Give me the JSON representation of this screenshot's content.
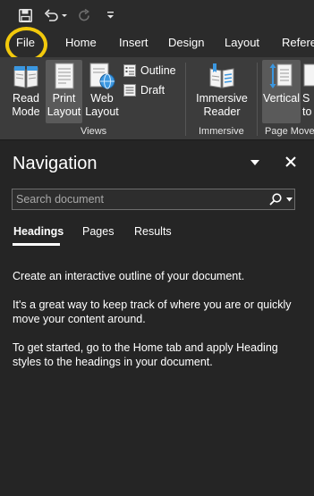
{
  "quick_access": {
    "save_icon": "save-icon",
    "undo_icon": "undo-icon",
    "redo_icon": "redo-icon",
    "customize_icon": "customize-toolbar-icon"
  },
  "ribbon_tabs": [
    "File",
    "Home",
    "Insert",
    "Design",
    "Layout",
    "Referen"
  ],
  "ribbon": {
    "views": {
      "read_mode": "Read\nMode",
      "print_layout": "Print\nLayout",
      "web_layout": "Web\nLayout",
      "outline": "Outline",
      "draft": "Draft",
      "group_label": "Views"
    },
    "immersive": {
      "immersive_reader": "Immersive\nReader",
      "group_label": "Immersive"
    },
    "page_movement": {
      "vertical": "Vertical",
      "side_to_side": "S\nto",
      "group_label": "Page Move"
    }
  },
  "navigation": {
    "title": "Navigation",
    "search_placeholder": "Search document",
    "tabs": [
      "Headings",
      "Pages",
      "Results"
    ],
    "active_tab": "Headings",
    "paragraphs": [
      "Create an interactive outline of your document.",
      "It's a great way to keep track of where you are or quickly move your content around.",
      "To get started, go to the Home tab and apply Heading styles to the headings in your document."
    ]
  },
  "colors": {
    "highlight_ring": "#f2c90c",
    "accent_blue": "#3b97e0",
    "background": "#252525"
  }
}
